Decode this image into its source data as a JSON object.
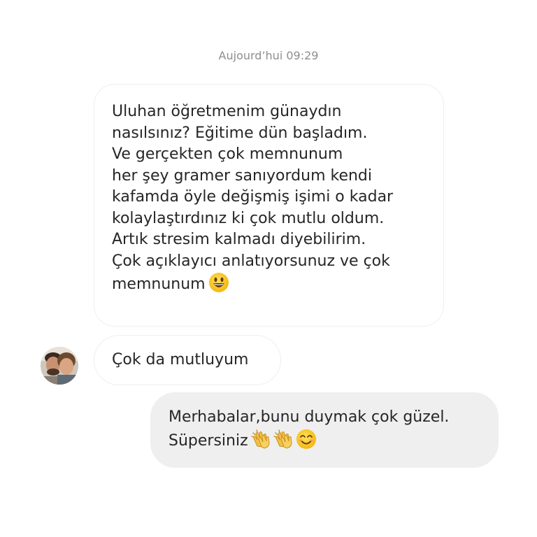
{
  "conversation": {
    "timestamp": "Aujourd’hui 09:29",
    "messages": [
      {
        "direction": "incoming",
        "lines": [
          "Uluhan öğretmenim günaydın",
          "nasılsınız? Eğitime dün başladım.",
          "Ve gerçekten çok memnunum",
          "her şey gramer sanıyordum kendi",
          "kafamda öyle değişmiş işimi o kadar",
          "kolaylaştırdınız ki çok mutlu oldum.",
          "Artık stresim kalmadı diyebilirim.",
          "Çok açıklayıcı anlatıyorsunuz ve çok",
          "memnunum"
        ],
        "emojis": [
          "grinning-face"
        ]
      },
      {
        "direction": "incoming",
        "text": "Çok da mutluyum",
        "has_avatar": true
      },
      {
        "direction": "outgoing",
        "lines": [
          "Merhabalar,bunu duymak çok güzel.",
          "Süpersiniz"
        ],
        "emojis": [
          "clapping-hands",
          "clapping-hands",
          "smiling-face-with-smiling-eyes"
        ]
      }
    ]
  },
  "colors": {
    "background": "#ffffff",
    "incoming_border": "#efefef",
    "outgoing_fill": "#efefef",
    "text": "#262626",
    "timestamp": "#8e8e8e"
  }
}
